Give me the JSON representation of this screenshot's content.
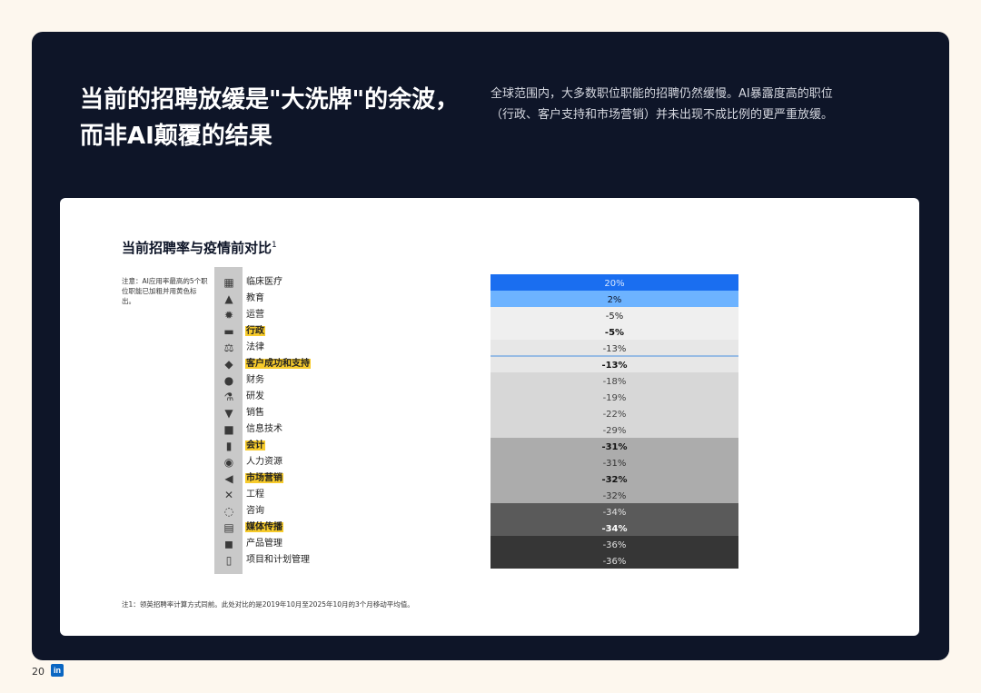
{
  "headline": "当前的招聘放缓是\"大洗牌\"的余波，而非AI颠覆的结果",
  "subtitle": "全球范围内，大多数职位职能的招聘仍然缓慢。AI暴露度高的职位（行政、客户支持和市场营销）并未出现不成比例的更严重放缓。",
  "chart_title": "当前招聘率与疫情前对比",
  "chart_title_sup": "1",
  "note": "注意：AI应用率最高的5个职位职能已加粗并用黄色标出。",
  "footnote": "注1：领英招聘率计算方式同前。此处对比的是2019年10月至2025年10月的3个月移动平均值。",
  "page_number": "20",
  "brand_logo": "in",
  "chart_data": {
    "type": "table",
    "categories": [
      "临床医疗",
      "教育",
      "运营",
      "行政",
      "法律",
      "客户成功和支持",
      "财务",
      "研发",
      "销售",
      "信息技术",
      "会计",
      "人力资源",
      "市场营销",
      "工程",
      "咨询",
      "媒体传播",
      "产品管理",
      "项目和计划管理"
    ],
    "values": [
      20,
      2,
      -5,
      -5,
      -13,
      -13,
      -18,
      -19,
      -22,
      -29,
      -31,
      -31,
      -32,
      -32,
      -34,
      -34,
      -36,
      -36
    ],
    "labels": [
      "20%",
      "2%",
      "-5%",
      "-5%",
      "-13%",
      "-13%",
      "-18%",
      "-19%",
      "-22%",
      "-29%",
      "-31%",
      "-31%",
      "-32%",
      "-32%",
      "-34%",
      "-34%",
      "-36%",
      "-36%"
    ],
    "highlighted": [
      false,
      false,
      false,
      true,
      false,
      true,
      false,
      false,
      false,
      false,
      true,
      false,
      true,
      false,
      false,
      true,
      false,
      false
    ],
    "icons": [
      "hospital-icon",
      "graduation-cap-icon",
      "gear-icon",
      "folder-icon",
      "scales-icon",
      "handshake-icon",
      "money-bag-icon",
      "microscope-icon",
      "cart-icon",
      "computer-icon",
      "bar-chart-icon",
      "people-icon",
      "megaphone-icon",
      "tools-icon",
      "lightbulb-icon",
      "newspaper-icon",
      "box-icon",
      "clipboard-icon"
    ],
    "band_colors": [
      "#1a6ef0",
      "#6db3ff",
      "#efefef",
      "#efefef",
      "#e7e7e7",
      "#e7e7e7",
      "#d7d7d7",
      "#d7d7d7",
      "#d7d7d7",
      "#d7d7d7",
      "#acacac",
      "#acacac",
      "#acacac",
      "#acacac",
      "#5a5a5a",
      "#5a5a5a",
      "#363636",
      "#363636"
    ],
    "text_colors": [
      "#d6e6ff",
      "#0e1528",
      "#222222",
      "#111111",
      "#333333",
      "#111111",
      "#444444",
      "#444444",
      "#444444",
      "#444444",
      "#111111",
      "#333333",
      "#111111",
      "#333333",
      "#e0e0e0",
      "#ffffff",
      "#e0e0e0",
      "#e0e0e0"
    ]
  }
}
